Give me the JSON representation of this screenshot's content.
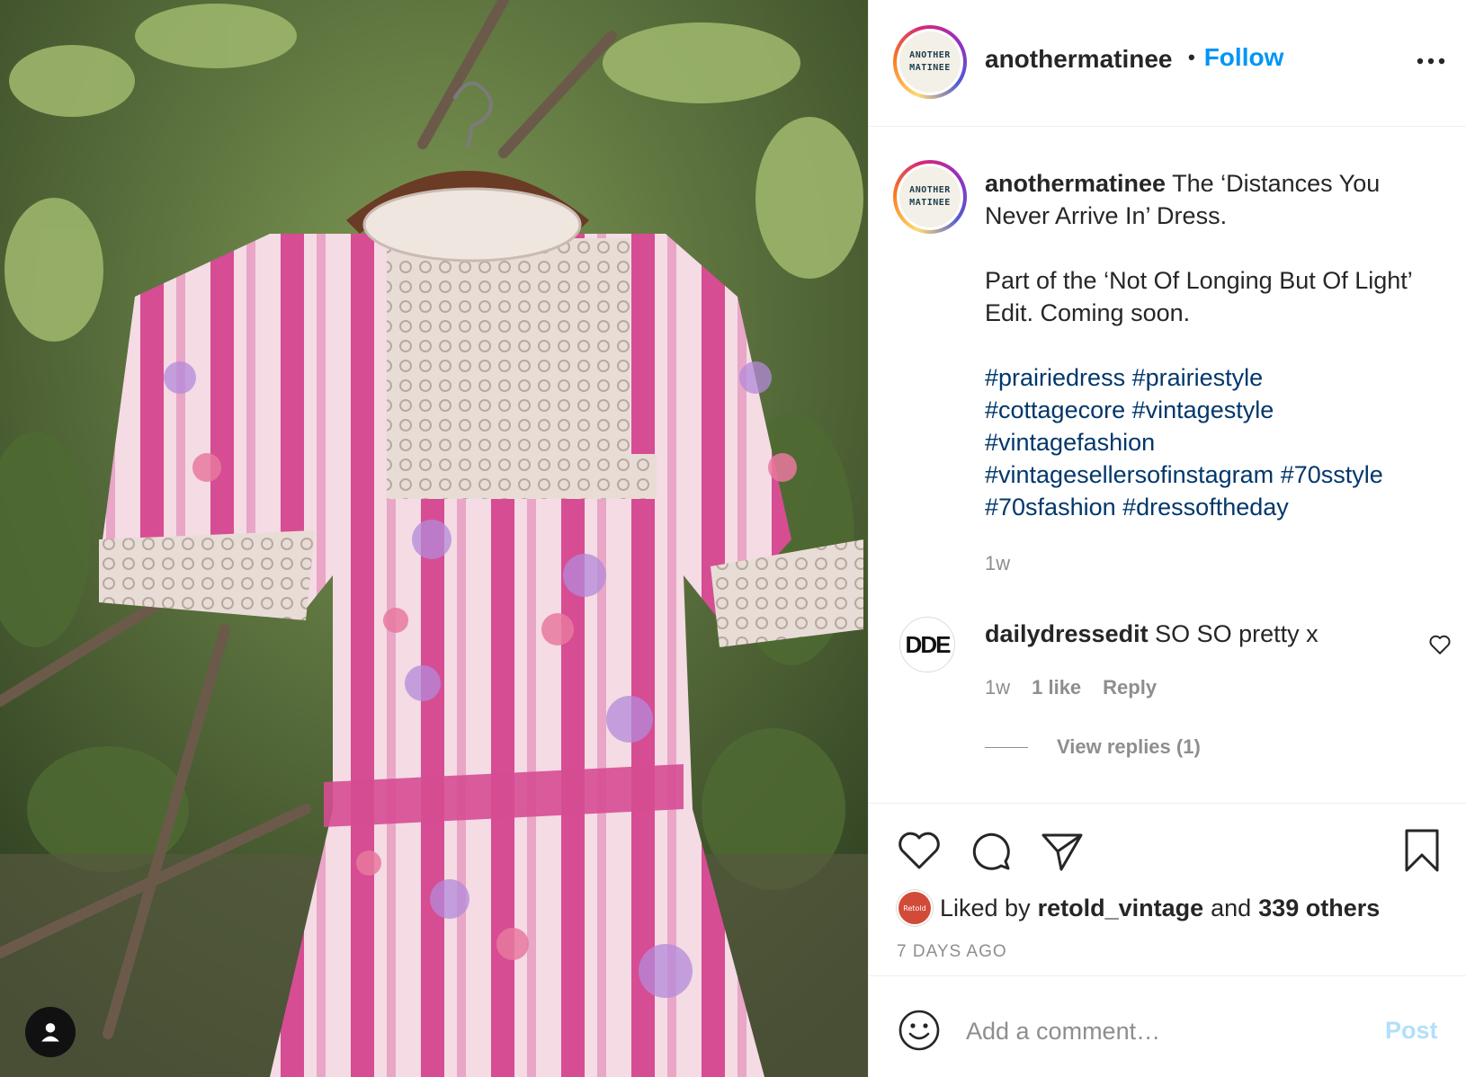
{
  "post": {
    "author": {
      "username": "anothermatinee",
      "avatar_text_line1": "ANOTHER",
      "avatar_text_line2": "MATINEE"
    },
    "header": {
      "bullet": "•",
      "follow_label": "Follow",
      "more_icon": "more-horizontal-icon"
    },
    "caption": {
      "username": "anothermatinee",
      "line1": "The ‘Distances You Never Arrive In’ Dress.",
      "line2": "Part of the ‘Not Of Longing But Of Light’ Edit. Coming soon.",
      "hashtags": [
        "#prairiedress",
        "#prairiestyle",
        "#cottagecore",
        "#vintagestyle",
        "#vintagefashion",
        "#vintagesellersofinstagram",
        "#70sstyle",
        "#70sfashion",
        "#dressoftheday"
      ],
      "time": "1w"
    },
    "comments": [
      {
        "avatar_text": "DDE",
        "username": "dailydressedit",
        "text": "SO SO pretty x",
        "time": "1w",
        "likes": "1 like",
        "reply_label": "Reply",
        "view_replies": "View replies (1)"
      }
    ],
    "likes": {
      "prefix": "Liked by",
      "user": "retold_vintage",
      "and": "and",
      "others": "339 others",
      "avatar_text": "Retold"
    },
    "date_ago": "7 DAYS AGO",
    "add_comment": {
      "placeholder": "Add a comment…",
      "post_label": "Post"
    },
    "colors": {
      "accent": "#0095f6",
      "hashtag": "#00376b",
      "muted": "#8e8e8e",
      "post_disabled": "#b2dffc"
    }
  }
}
